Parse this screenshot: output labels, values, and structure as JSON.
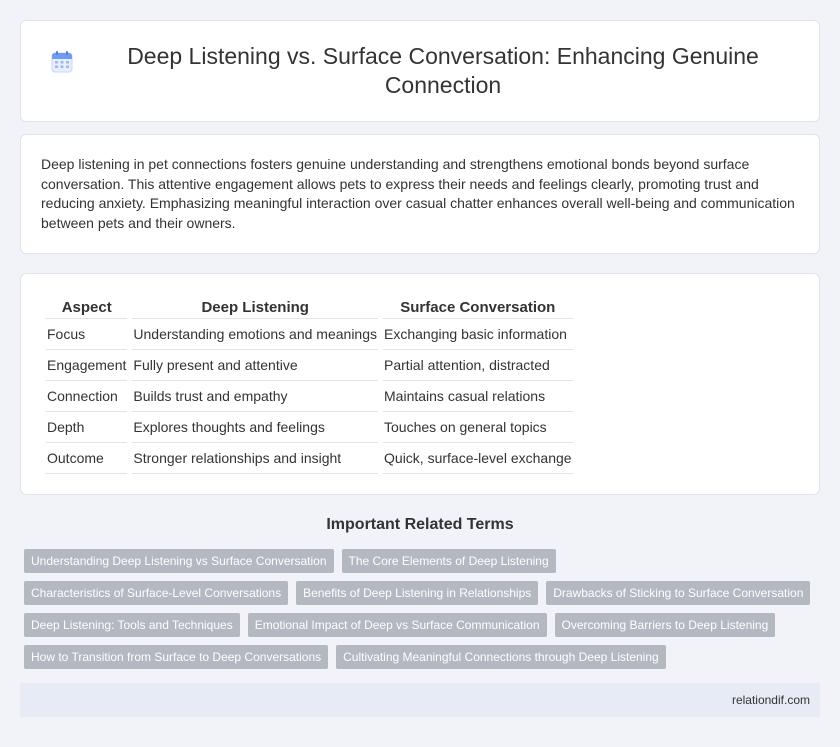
{
  "header": {
    "title": "Deep Listening vs. Surface Conversation: Enhancing Genuine Connection",
    "icon": "calendar-icon"
  },
  "intro": {
    "text": "Deep listening in pet connections fosters genuine understanding and strengthens emotional bonds beyond surface conversation. This attentive engagement allows pets to express their needs and feelings clearly, promoting trust and reducing anxiety. Emphasizing meaningful interaction over casual chatter enhances overall well-being and communication between pets and their owners."
  },
  "table": {
    "headers": [
      "Aspect",
      "Deep Listening",
      "Surface Conversation"
    ],
    "rows": [
      [
        "Focus",
        "Understanding emotions and meanings",
        "Exchanging basic information"
      ],
      [
        "Engagement",
        "Fully present and attentive",
        "Partial attention, distracted"
      ],
      [
        "Connection",
        "Builds trust and empathy",
        "Maintains casual relations"
      ],
      [
        "Depth",
        "Explores thoughts and feelings",
        "Touches on general topics"
      ],
      [
        "Outcome",
        "Stronger relationships and insight",
        "Quick, surface-level exchange"
      ]
    ]
  },
  "related": {
    "title": "Important Related Terms",
    "tags": [
      "Understanding Deep Listening vs Surface Conversation",
      "The Core Elements of Deep Listening",
      "Characteristics of Surface-Level Conversations",
      "Benefits of Deep Listening in Relationships",
      "Drawbacks of Sticking to Surface Conversation",
      "Deep Listening: Tools and Techniques",
      "Emotional Impact of Deep vs Surface Communication",
      "Overcoming Barriers to Deep Listening",
      "How to Transition from Surface to Deep Conversations",
      "Cultivating Meaningful Connections through Deep Listening"
    ]
  },
  "footer": {
    "site": "relationdif.com"
  },
  "colors": {
    "background": "#f1f3f8",
    "tag_bg": "#b3b8c1",
    "footer_bg": "#e6ebf5",
    "icon_accent": "#5b8def"
  }
}
